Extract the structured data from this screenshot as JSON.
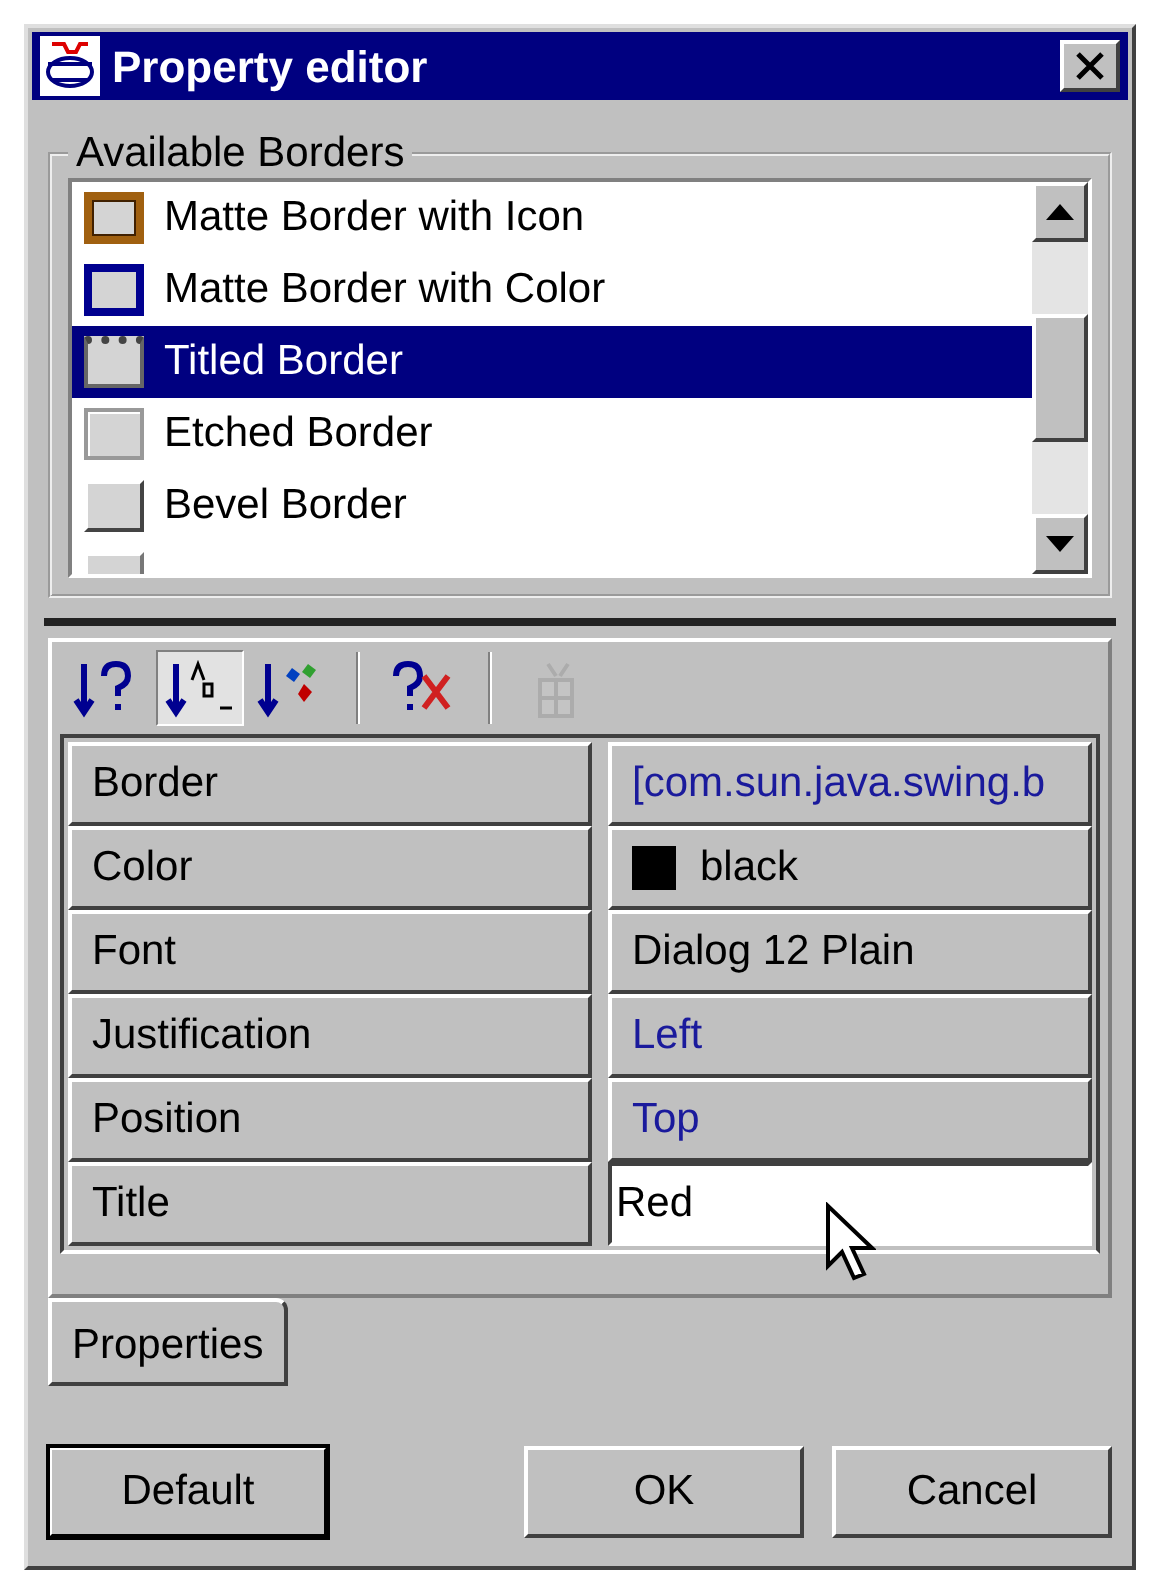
{
  "window": {
    "title": "Property editor"
  },
  "borders_group": {
    "title": "Available Borders",
    "items": [
      {
        "label": "Matte Border with Icon",
        "kind": "matte-icon",
        "selected": false
      },
      {
        "label": "Matte Border with Color",
        "kind": "matte-color",
        "selected": false
      },
      {
        "label": "Titled Border",
        "kind": "titled",
        "selected": true
      },
      {
        "label": "Etched Border",
        "kind": "etched",
        "selected": false
      },
      {
        "label": "Bevel Border",
        "kind": "bevel",
        "selected": false
      },
      {
        "kind": "soft-bevel",
        "selected": false
      }
    ]
  },
  "toolbar": [
    {
      "kind": "sort-question",
      "selected": false,
      "disabled": false
    },
    {
      "kind": "sort-alpha",
      "selected": true,
      "disabled": false
    },
    {
      "kind": "sort-category",
      "selected": false,
      "disabled": false
    },
    {
      "kind": "clear",
      "selected": false,
      "disabled": false
    },
    {
      "kind": "grid",
      "selected": false,
      "disabled": true
    }
  ],
  "properties": [
    {
      "name": "Border",
      "kind": "link",
      "value": "[com.sun.java.swing.b"
    },
    {
      "name": "Color",
      "kind": "color",
      "value": "black",
      "color": "#000000"
    },
    {
      "name": "Font",
      "kind": "text",
      "value": "Dialog 12 Plain"
    },
    {
      "name": "Justification",
      "kind": "link",
      "value": "Left"
    },
    {
      "name": "Position",
      "kind": "link",
      "value": "Top"
    },
    {
      "name": "Title",
      "kind": "field",
      "value": "Red"
    }
  ],
  "tabs": [
    {
      "label": "Properties",
      "selected": true
    }
  ],
  "buttons": [
    {
      "label": "Default",
      "default": true
    },
    {
      "label": "OK",
      "default": false
    },
    {
      "label": "Cancel",
      "default": false
    }
  ]
}
